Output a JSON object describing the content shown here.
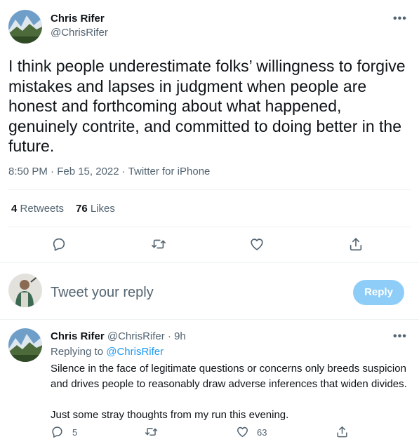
{
  "main_tweet": {
    "author_name": "Chris Rifer",
    "author_handle": "@ChrisRifer",
    "more_label": "•••",
    "text": "I think people underestimate folks’ willingness to forgive mistakes and lapses in judgment when people are honest and forthcoming about what happened, genuinely contrite, and committed to doing better in the future.",
    "timestamp": "8:50 PM · Feb 15, 2022 · Twitter for iPhone",
    "retweets_count": "4",
    "retweets_label": "Retweets",
    "likes_count": "76",
    "likes_label": "Likes"
  },
  "actions": [
    "reply-icon",
    "retweet-icon",
    "like-icon",
    "share-icon"
  ],
  "composer": {
    "placeholder": "Tweet your reply",
    "reply_button": "Reply"
  },
  "reply_tweet": {
    "author_name": "Chris Rifer",
    "meta": "@ChrisRifer · 9h",
    "more_label": "•••",
    "replying_prefix": "Replying to",
    "replying_handle": "@ChrisRifer",
    "paragraph1": "Silence in the face of legitimate questions or concerns only breeds suspicion and drives people to reasonably draw adverse inferences that widen divides.",
    "paragraph2": "Just some stray thoughts from my run this evening.",
    "reply_count": "5",
    "like_count": "63"
  },
  "colors": {
    "accent": "#1d9bf0",
    "reply_button_disabled": "#8ecdf8",
    "muted_text": "#536471",
    "divider": "#eff3f4"
  }
}
